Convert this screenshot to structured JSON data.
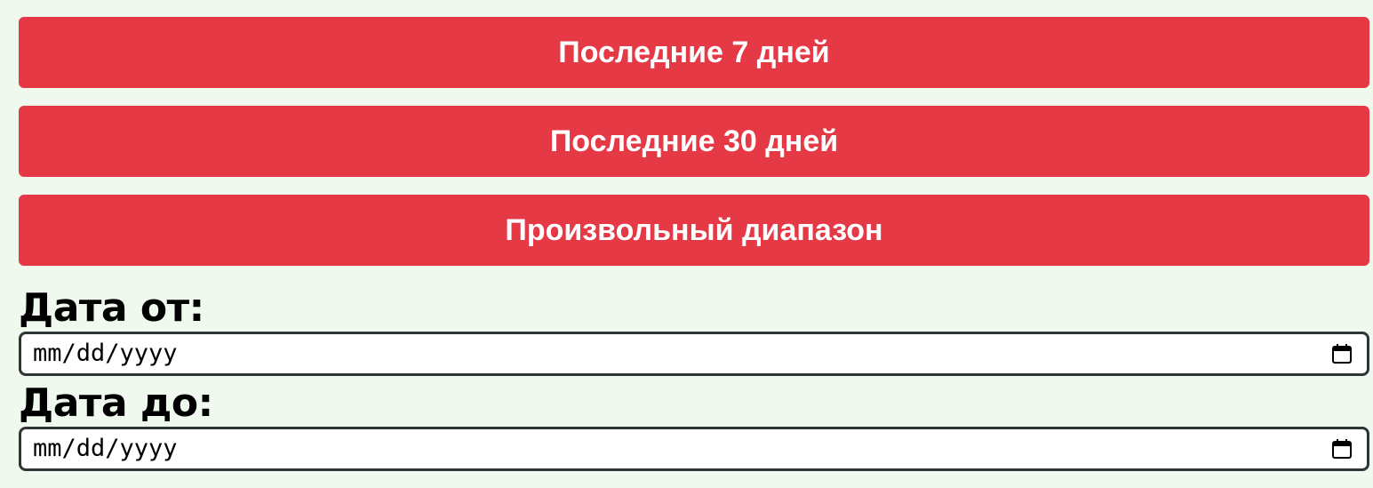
{
  "range_buttons": {
    "last7": "Последние 7 дней",
    "last30": "Последние 30 дней",
    "custom": "Произвольный диапазон"
  },
  "date_from": {
    "label": "Дата от:",
    "placeholder": "mm/dd/yyyy",
    "icon": "calendar-icon"
  },
  "date_to": {
    "label": "Дата до:",
    "placeholder": "mm/dd/yyyy",
    "icon": "calendar-icon"
  },
  "colors": {
    "button_bg": "#e63946",
    "page_bg": "#f0f9ee",
    "input_border": "#2f3437"
  }
}
